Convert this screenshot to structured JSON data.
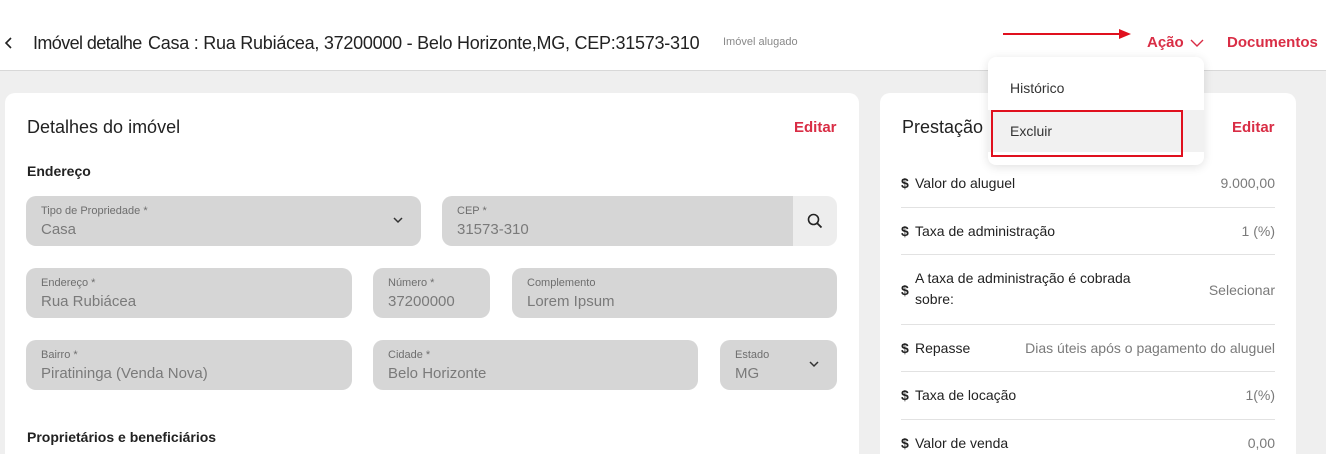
{
  "header": {
    "title_prefix": "Imóvel detalhe",
    "title_address": "Casa : Rua Rubiácea, 37200000 - Belo Horizonte,MG, CEP:31573-310",
    "status": "Imóvel alugado",
    "action_label": "Ação",
    "documents_label": "Documentos"
  },
  "dropdown": {
    "items": [
      {
        "label": "Histórico"
      },
      {
        "label": "Excluir"
      }
    ]
  },
  "details": {
    "title": "Detalhes do imóvel",
    "edit_label": "Editar",
    "address_section": "Endereço",
    "owners_section": "Proprietários e beneficiários",
    "fields": {
      "property_type": {
        "label": "Tipo de Propriedade *",
        "value": "Casa"
      },
      "cep": {
        "label": "CEP *",
        "value": "31573-310"
      },
      "street": {
        "label": "Endereço *",
        "value": "Rua Rubiácea"
      },
      "number": {
        "label": "Número *",
        "value": "37200000"
      },
      "complement": {
        "label": "Complemento",
        "value": "Lorem Ipsum"
      },
      "neighborhood": {
        "label": "Bairro *",
        "value": "Piratininga (Venda Nova)"
      },
      "city": {
        "label": "Cidade *",
        "value": "Belo Horizonte"
      },
      "state": {
        "label": "Estado",
        "value": "MG"
      }
    }
  },
  "services": {
    "title": "Prestação",
    "edit_label": "Editar",
    "rows": [
      {
        "label": "Valor do aluguel",
        "value": "9.000,00"
      },
      {
        "label": "Taxa de administração",
        "value": "1 (%)"
      },
      {
        "label": "A taxa de administração é cobrada sobre:",
        "value": "Selecionar"
      },
      {
        "label": "Repasse",
        "value": "Dias úteis após o pagamento do aluguel"
      },
      {
        "label": "Taxa de locação",
        "value": "1(%)"
      },
      {
        "label": "Valor de venda",
        "value": "0,00"
      }
    ],
    "currency_symbol": "$"
  },
  "colors": {
    "accent": "#d92d45",
    "highlight_box": "#e0101e",
    "field_bg": "#d6d6d6",
    "page_bg": "#efefef"
  }
}
